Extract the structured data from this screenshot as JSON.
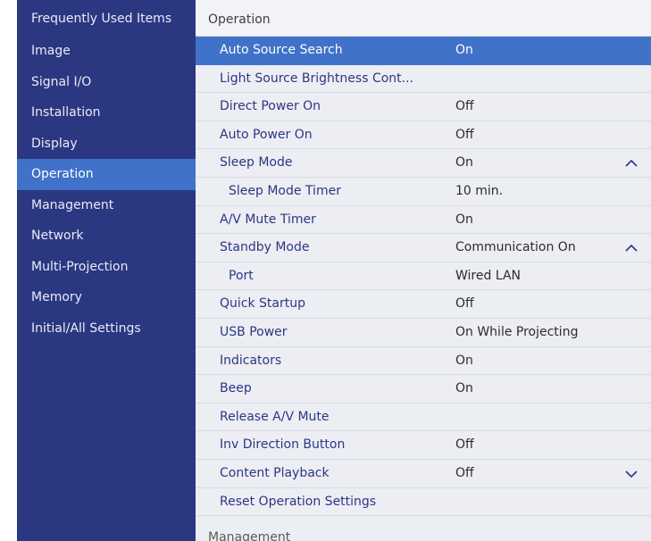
{
  "sidebar": {
    "items": [
      {
        "label": "Frequently Used Items"
      },
      {
        "label": "Image"
      },
      {
        "label": "Signal I/O"
      },
      {
        "label": "Installation"
      },
      {
        "label": "Display"
      },
      {
        "label": "Operation"
      },
      {
        "label": "Management"
      },
      {
        "label": "Network"
      },
      {
        "label": "Multi-Projection"
      },
      {
        "label": "Memory"
      },
      {
        "label": "Initial/All Settings"
      }
    ],
    "active_index": 5
  },
  "panel": {
    "title": "Operation",
    "rows": [
      {
        "label": "Auto Source Search",
        "value": "On"
      },
      {
        "label": "Light Source Brightness Cont...",
        "value": ""
      },
      {
        "label": "Direct Power On",
        "value": "Off"
      },
      {
        "label": "Auto Power On",
        "value": "Off"
      },
      {
        "label": "Sleep Mode",
        "value": "On"
      },
      {
        "label": "Sleep Mode Timer",
        "value": "10 min."
      },
      {
        "label": "A/V Mute Timer",
        "value": "On"
      },
      {
        "label": "Standby Mode",
        "value": "Communication On"
      },
      {
        "label": "Port",
        "value": "Wired LAN"
      },
      {
        "label": "Quick Startup",
        "value": "Off"
      },
      {
        "label": "USB Power",
        "value": "On While Projecting"
      },
      {
        "label": "Indicators",
        "value": "On"
      },
      {
        "label": "Beep",
        "value": "On"
      },
      {
        "label": "Release A/V Mute",
        "value": ""
      },
      {
        "label": "Inv Direction Button",
        "value": "Off"
      },
      {
        "label": "Content Playback",
        "value": "Off"
      },
      {
        "label": "Reset Operation Settings",
        "value": ""
      }
    ],
    "chevrons": {
      "up": "^",
      "down": "∨"
    },
    "next_section": "Management"
  },
  "colors": {
    "sidebar_bg": "#2c3781",
    "highlight": "#3f72c8",
    "panel_bg": "#eceef4",
    "label_text": "#2c3781"
  },
  "icons": [
    "chevron-up-icon",
    "chevron-down-icon"
  ]
}
